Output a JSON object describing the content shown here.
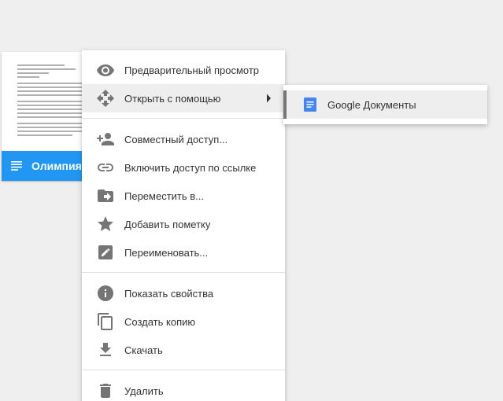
{
  "file_card": {
    "name": "Олимпия.Р"
  },
  "context_menu": {
    "items": [
      {
        "label": "Предварительный просмотр",
        "icon": "eye-icon"
      },
      {
        "label": "Открыть с помощью",
        "icon": "move-arrows-icon"
      },
      {
        "label": "Совместный доступ...",
        "icon": "person-add-icon"
      },
      {
        "label": "Включить доступ по ссылке",
        "icon": "link-icon"
      },
      {
        "label": "Переместить в...",
        "icon": "folder-move-icon"
      },
      {
        "label": "Добавить пометку",
        "icon": "star-icon"
      },
      {
        "label": "Переименовать...",
        "icon": "edit-icon"
      },
      {
        "label": "Показать свойства",
        "icon": "info-icon"
      },
      {
        "label": "Создать копию",
        "icon": "copy-icon"
      },
      {
        "label": "Скачать",
        "icon": "download-icon"
      },
      {
        "label": "Удалить",
        "icon": "trash-icon"
      }
    ]
  },
  "submenu": {
    "items": [
      {
        "label": "Google Документы",
        "icon": "google-docs-icon"
      }
    ]
  },
  "colors": {
    "accent_blue": "#2196f3",
    "docs_blue": "#4285f4",
    "icon_grey": "#757575"
  }
}
